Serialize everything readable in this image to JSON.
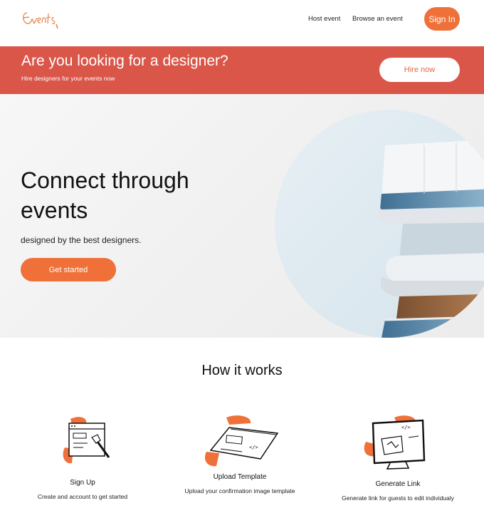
{
  "header": {
    "logo_text": "Events",
    "nav": [
      {
        "label": "Host event"
      },
      {
        "label": "Browse an event"
      }
    ],
    "signin_label": "Sign In"
  },
  "banner": {
    "title": "Are you looking for a designer?",
    "subtitle": "Hire designers for your events now",
    "button_label": "Hire now"
  },
  "hero": {
    "title": "Connect through events",
    "subtitle": "designed by the best designers.",
    "button_label": "Get started",
    "image": "modern-building-photo"
  },
  "how_it_works": {
    "title": "How it works",
    "steps": [
      {
        "title": "Sign Up",
        "description": "Create and account to get started",
        "icon": "browser-sketch-icon"
      },
      {
        "title": "Upload Template",
        "description": "Upload your confirmation image template",
        "icon": "template-card-icon"
      },
      {
        "title": "Generate Link",
        "description": "Generate link for guests to edit individualy",
        "icon": "monitor-link-icon"
      }
    ]
  },
  "colors": {
    "accent": "#ef7139",
    "banner": "#da5649",
    "white": "#ffffff"
  }
}
